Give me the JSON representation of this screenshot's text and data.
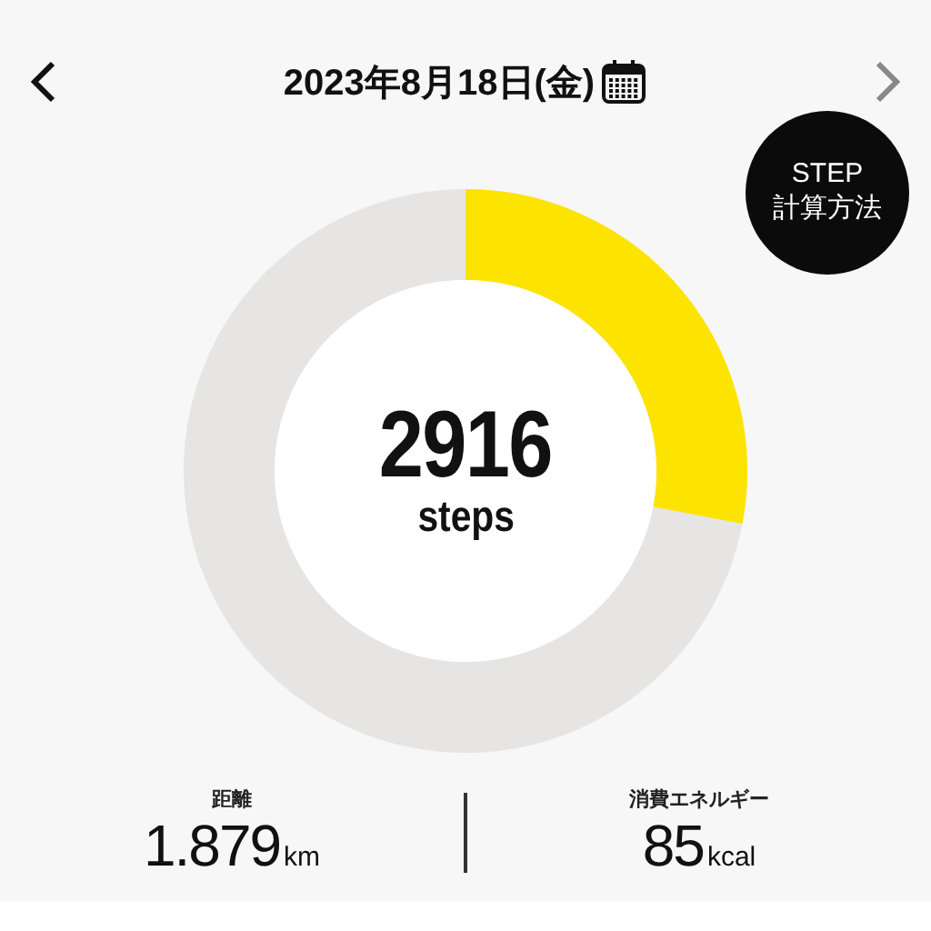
{
  "header": {
    "title": "2023年8月18日(金)"
  },
  "ring": {
    "value": "2916",
    "unit": "steps"
  },
  "step_button": {
    "line1": "STEP",
    "line2": "計算方法"
  },
  "stats": [
    {
      "label": "距離",
      "value": "1.879",
      "unit": "km"
    },
    {
      "label": "消費エネルギー",
      "value": "85",
      "unit": "kcal"
    }
  ]
}
